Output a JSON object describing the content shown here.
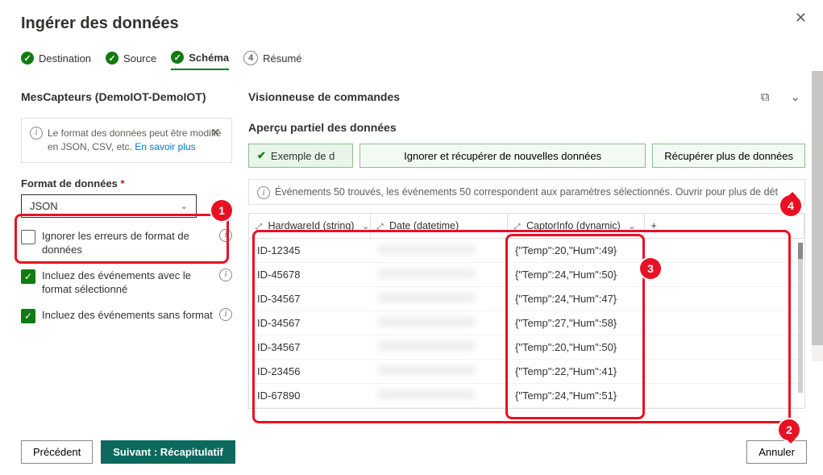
{
  "title": "Ingérer des données",
  "steps": {
    "destination": "Destination",
    "source": "Source",
    "schema": "Schéma",
    "summary_num": "4",
    "summary": "Résumé"
  },
  "left": {
    "heading": "MesCapteurs (DemoIOT-DemoIOT)",
    "notice": "Le format des données peut être modifié en JSON, CSV, etc.",
    "notice_link": "En savoir plus",
    "format_label": "Format de données",
    "format_value": "JSON",
    "ignore_errors": "Ignorer les erreurs de format de données",
    "include_with_format": "Incluez des événements avec le format sélectionné",
    "include_without_format": "Incluez des événements sans format"
  },
  "right": {
    "viewer_heading": "Visionneuse de commandes",
    "preview_heading": "Aperçu partiel des données",
    "example_chip": "Exemple de d",
    "btn_ignore": "Ignorer et récupérer de nouvelles données",
    "btn_more": "Récupérer plus de données",
    "events_info": "Événements 50 trouvés, les événements 50 correspondent aux paramètres sélectionnés. Ouvrir pour plus de dét",
    "columns": {
      "c1": "HardwareId (string)",
      "c2": "Date (datetime)",
      "c3": "CaptorInfo (dynamic)"
    },
    "rows": [
      {
        "id": "ID-12345",
        "info": "{\"Temp\":20,\"Hum\":49}"
      },
      {
        "id": "ID-45678",
        "info": "{\"Temp\":24,\"Hum\":50}"
      },
      {
        "id": "ID-34567",
        "info": "{\"Temp\":24,\"Hum\":47}"
      },
      {
        "id": "ID-34567",
        "info": "{\"Temp\":27,\"Hum\":58}"
      },
      {
        "id": "ID-34567",
        "info": "{\"Temp\":20,\"Hum\":50}"
      },
      {
        "id": "ID-23456",
        "info": "{\"Temp\":22,\"Hum\":41}"
      },
      {
        "id": "ID-67890",
        "info": "{\"Temp\":24,\"Hum\":51}"
      }
    ]
  },
  "footer": {
    "prev": "Précédent",
    "next": "Suivant : Récapitulatif",
    "cancel": "Annuler"
  },
  "callouts": {
    "c1": "1",
    "c2": "2",
    "c3": "3",
    "c4": "4"
  }
}
